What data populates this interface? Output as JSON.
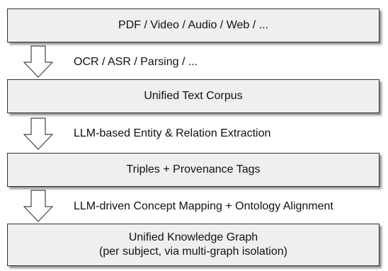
{
  "boxes": [
    {
      "text": "PDF / Video / Audio / Web / ..."
    },
    {
      "text": "Unified Text Corpus"
    },
    {
      "text": "Triples + Provenance Tags"
    },
    {
      "line1": "Unified Knowledge Graph",
      "line2": "(per subject, via multi-graph isolation)"
    }
  ],
  "steps": [
    {
      "label": "OCR / ASR / Parsing / ..."
    },
    {
      "label": "LLM-based Entity & Relation Extraction"
    },
    {
      "label": "LLM-driven Concept Mapping + Ontology Alignment"
    }
  ]
}
